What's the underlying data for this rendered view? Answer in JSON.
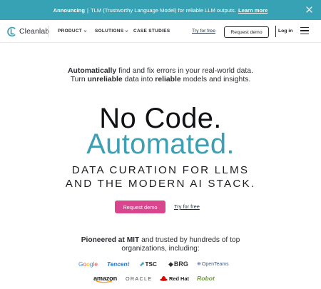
{
  "announcement": {
    "lead": "Announcing",
    "separator": "|",
    "text": "TLM (Trustworthy Language Model) for reliable LLM outputs.",
    "link": "Learn more",
    "close_icon": "close-icon"
  },
  "nav": {
    "logo_text": "Cleanlab",
    "items": [
      {
        "label": "PRODUCT",
        "has_chevron": true
      },
      {
        "label": "SOLUTIONS",
        "has_chevron": true
      },
      {
        "label": "CASE STUDIES",
        "has_chevron": false
      }
    ],
    "try_free": "Try for free",
    "request_demo": "Request demo",
    "login": "Log in",
    "menu_icon": "hamburger-menu-icon"
  },
  "hero": {
    "lead_line1": {
      "bold": "Automatically",
      "rest": " find and fix errors in your real-world data."
    },
    "lead_line2": {
      "p1": "Turn ",
      "b1": "unreliable",
      "p2": " data into ",
      "b2": "reliable",
      "p3": " models and insights."
    },
    "title_line1": "No Code.",
    "title_line2": "Automated.",
    "subtitle_line1": "DATA CURATION FOR LLMS",
    "subtitle_line2": "AND THE MODERN AI STACK.",
    "cta_primary": "Request demo",
    "cta_secondary": "Try for free",
    "accent_color": "#3e9fb2",
    "button_color": "#d8468d",
    "banner_color": "#37a2b3"
  },
  "trust": {
    "line1": {
      "bold": "Pioneered at MIT",
      "rest": " and trusted by hundreds of top"
    },
    "line2": "organizations, including:",
    "logos_row1": [
      "Google",
      "Tencent",
      "TSC",
      "BRG",
      "OpenTeams"
    ],
    "logos_row2": [
      "amazon",
      "ORACLE",
      "Red Hat",
      "Robot"
    ]
  }
}
